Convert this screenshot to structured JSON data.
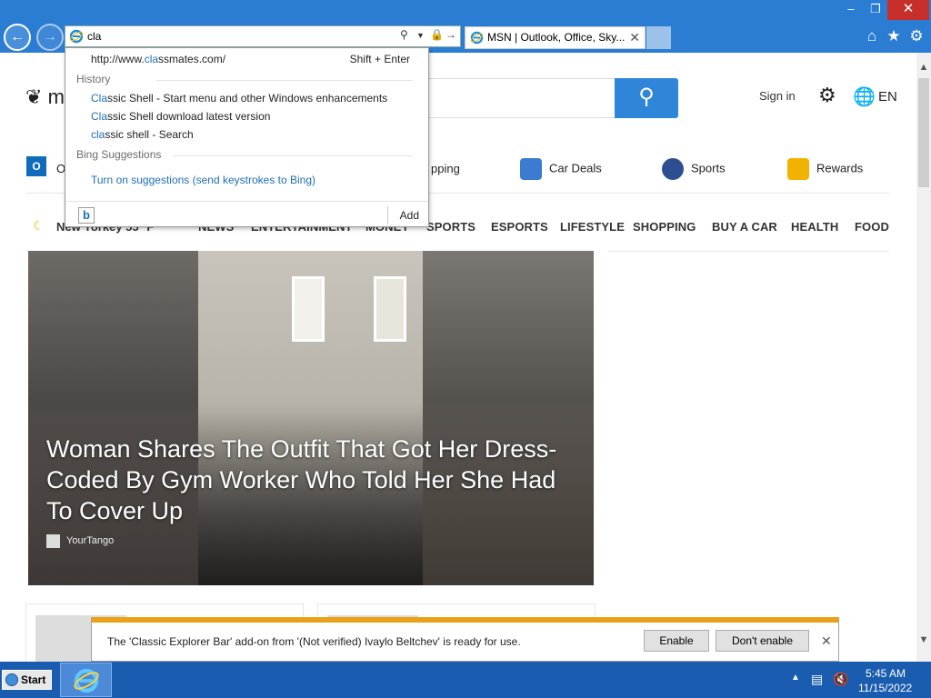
{
  "window": {
    "minimize_glyph": "–",
    "maximize_glyph": "❐",
    "close_glyph": "✕"
  },
  "address_bar": {
    "value": "cla"
  },
  "tab": {
    "title": "MSN | Outlook, Office, Sky...",
    "close_glyph": "✕"
  },
  "autocomplete": {
    "top_url_pre": "http://www.",
    "top_url_hl": "cla",
    "top_url_post": "ssmates.com/",
    "top_hint": "Shift + Enter",
    "history_label": "History",
    "history": [
      {
        "hl": "Cla",
        "rest": "ssic Shell - Start menu and other Windows enhancements"
      },
      {
        "hl": "Cla",
        "rest": "ssic Shell download latest version"
      },
      {
        "hl": "cla",
        "rest": "ssic shell - Search"
      }
    ],
    "bing_label": "Bing Suggestions",
    "bing_link": "Turn on suggestions (send keystrokes to Bing)",
    "bing_glyph": "b",
    "add_label": "Add"
  },
  "msn": {
    "logo_text": "m",
    "sign_in": "Sign in",
    "lang": "EN",
    "outlook_text": "O",
    "quicklinks": [
      {
        "label": "pping"
      },
      {
        "label": "Car Deals"
      },
      {
        "label": "Sports"
      },
      {
        "label": "Rewards"
      }
    ],
    "weather": "New Yorkey 55 °F",
    "categories": [
      "NEWS",
      "ENTERTAINMENT",
      "MONEY",
      "SPORTS",
      "ESPORTS",
      "LIFESTYLE",
      "SHOPPING",
      "BUY A CAR",
      "HEALTH",
      "FOOD"
    ],
    "hero_title": "Woman Shares The Outfit That Got Her Dress-Coded By Gym Worker Who Told Her She Had To Cover Up",
    "hero_source": "YourTango"
  },
  "notification": {
    "text": "The 'Classic Explorer Bar' add-on from '(Not verified) Ivaylo Beltchev' is ready for use.",
    "enable": "Enable",
    "dont_enable": "Don't enable",
    "close_glyph": "✕"
  },
  "taskbar": {
    "start": "Start",
    "time": "5:45 AM",
    "date": "11/15/2022"
  },
  "colors": {
    "chrome": "#2b7cd3",
    "close_btn": "#c7302a",
    "search_btn": "#2f86d9",
    "notif_accent": "#e8a21a",
    "taskbar": "#1a5db0",
    "highlight": "#1f6fb5"
  }
}
